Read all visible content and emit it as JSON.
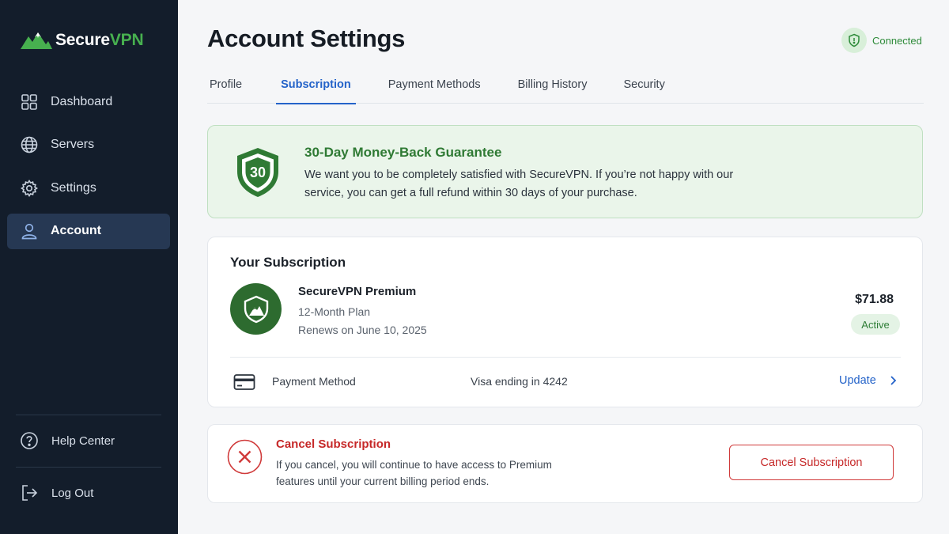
{
  "sidebar": {
    "brand_part1": "Secure",
    "brand_part2": "VPN",
    "items": [
      {
        "label": "Dashboard",
        "icon": "grid-icon"
      },
      {
        "label": "Servers",
        "icon": "globe-icon"
      },
      {
        "label": "Settings",
        "icon": "gear-icon"
      },
      {
        "label": "Account",
        "icon": "user-icon"
      }
    ],
    "help_label": "Help Center",
    "logout_label": "Log Out"
  },
  "header": {
    "title": "Account Settings",
    "status": "Connected"
  },
  "tabs": [
    "Profile",
    "Subscription",
    "Payment Methods",
    "Billing History",
    "Security"
  ],
  "active_tab": "Subscription",
  "guarantee": {
    "badge_number": "30",
    "title": "30-Day Money-Back Guarantee",
    "text": "We want you to be completely satisfied with SecureVPN. If you’re not happy with our service, you can get a full refund within 30 days of your purchase."
  },
  "subscription": {
    "heading": "Your Subscription",
    "plan_name": "SecureVPN Premium",
    "term": "12-Month Plan",
    "renews": "Renews on June 10, 2025",
    "price": "$71.88",
    "status": "Active",
    "payment_label": "Payment Method",
    "payment_value": "Visa ending in 4242",
    "update_label": "Update"
  },
  "cancel": {
    "title": "Cancel Subscription",
    "text": "If you cancel, you will continue to have access to Premium features until your current billing period ends.",
    "button_label": "Cancel Subscription"
  },
  "colors": {
    "sidebar_bg": "#131d2b",
    "accent_blue": "#2463c9",
    "brand_green": "#47b04f",
    "danger_red": "#c62828"
  }
}
